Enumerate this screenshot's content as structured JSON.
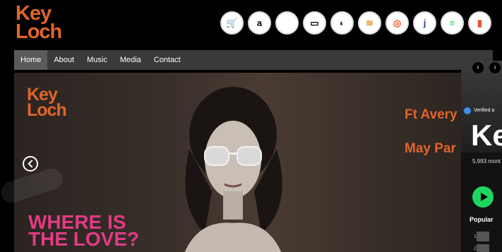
{
  "header": {
    "logo_line1": "Key",
    "logo_line2": "Loch"
  },
  "store_icons": [
    {
      "name": "cart-icon",
      "glyph": "🛒",
      "color": "#f0932b"
    },
    {
      "name": "amazon-icon",
      "glyph": "a",
      "color": "#000000"
    },
    {
      "name": "apple-icon",
      "glyph": "",
      "color": "#000000"
    },
    {
      "name": "airplay-icon",
      "glyph": "▭",
      "color": "#000000"
    },
    {
      "name": "napster-icon",
      "glyph": "◐",
      "color": "#333333"
    },
    {
      "name": "audiomack-icon",
      "glyph": "≋",
      "color": "#f0932b"
    },
    {
      "name": "sync-icon",
      "glyph": "◎",
      "color": "#e05a2b"
    },
    {
      "name": "jiosaavn-icon",
      "glyph": "j",
      "color": "#1f3f8f"
    },
    {
      "name": "spotify-icon",
      "glyph": "≡",
      "color": "#1ed760"
    },
    {
      "name": "deezer-icon",
      "glyph": "▮",
      "color": "#e05a2b"
    }
  ],
  "nav": [
    {
      "label": "Home",
      "active": true
    },
    {
      "label": "About"
    },
    {
      "label": "Music"
    },
    {
      "label": "Media"
    },
    {
      "label": "Contact"
    }
  ],
  "hero": {
    "logo_line1": "Key",
    "logo_line2": "Loch",
    "ft_line1": "Ft Avery",
    "ft_line2": "May Par",
    "title_line1": "WHERE IS",
    "title_line2": "THE LOVE?"
  },
  "spotify": {
    "verified": "Verified a",
    "artist_initial": "Ke",
    "listeners": "5,993 mont",
    "popular": "Popular"
  },
  "colors": {
    "brand": "#e0652a",
    "hero_title": "#e23a84",
    "spotify_green": "#1ed760"
  }
}
